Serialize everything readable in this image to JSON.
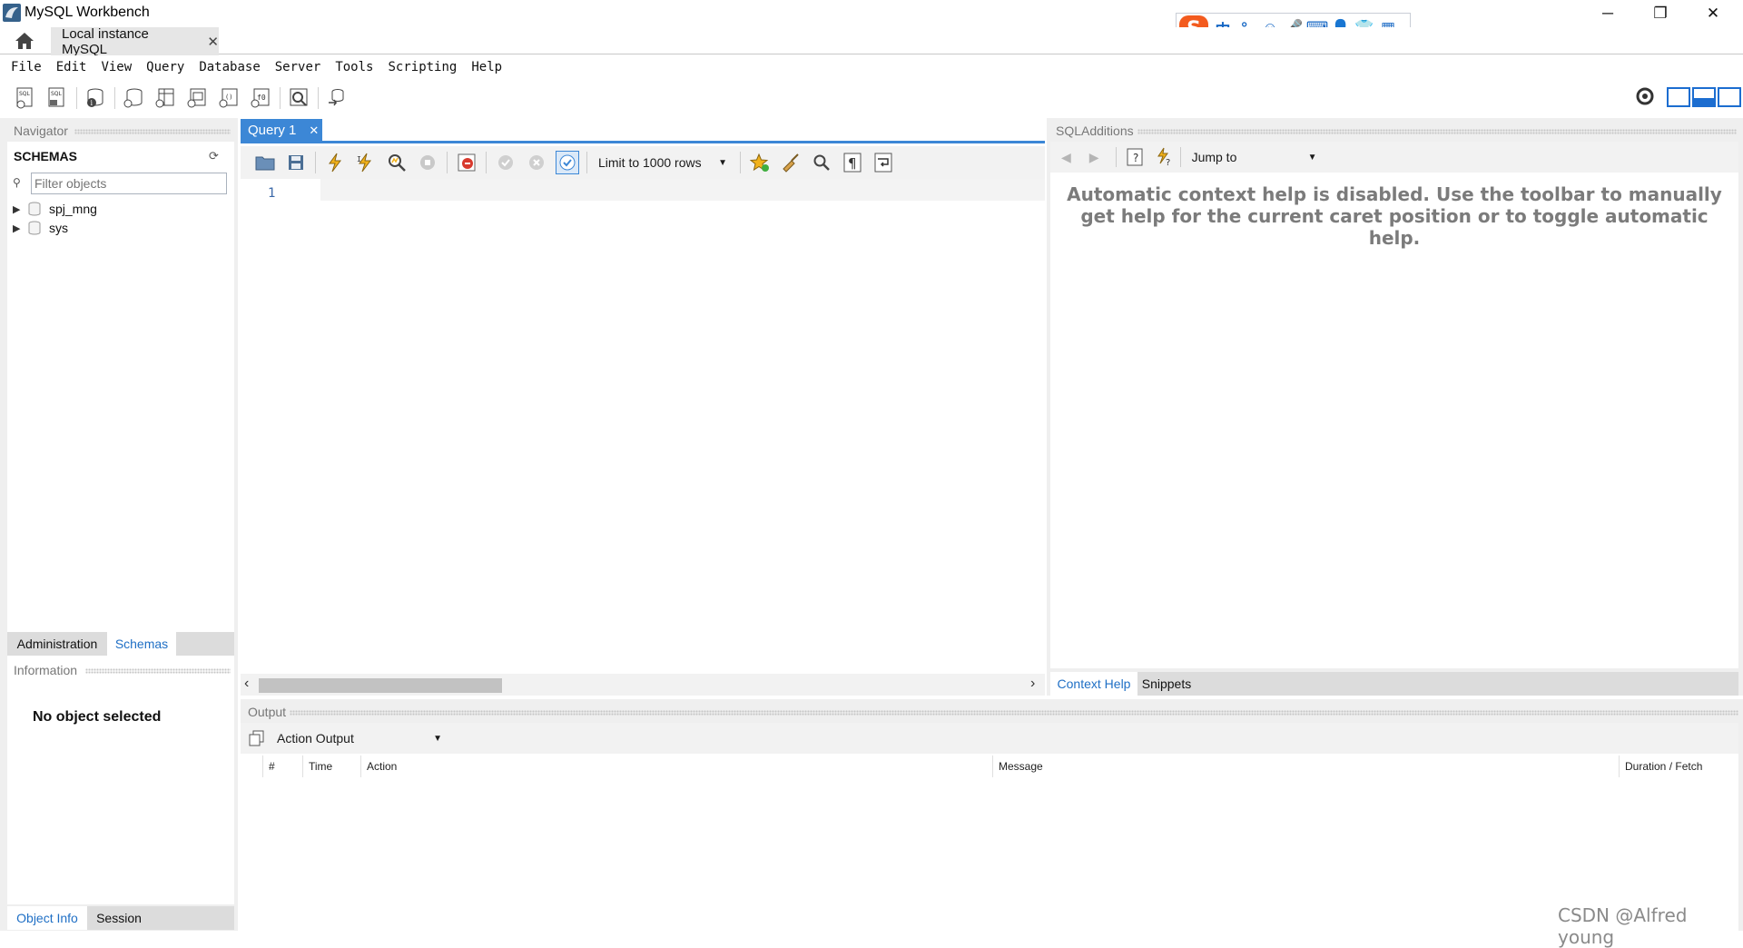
{
  "window": {
    "title": "MySQL Workbench",
    "controls": [
      "─",
      "❐",
      "✕"
    ]
  },
  "ime": {
    "items": [
      "中",
      "°,",
      "☺",
      "🎤",
      "⌨",
      "👤",
      "👕",
      "▦"
    ]
  },
  "tabs": {
    "connection_tab": "Local instance MySQL",
    "close": "✕"
  },
  "menu": {
    "items": [
      "File",
      "Edit",
      "View",
      "Query",
      "Database",
      "Server",
      "Tools",
      "Scripting",
      "Help"
    ]
  },
  "navigator": {
    "title": "Navigator",
    "schemas_heading": "SCHEMAS",
    "filter_placeholder": "Filter objects",
    "schemas": [
      "spj_mng",
      "sys"
    ],
    "tabs": [
      "Administration",
      "Schemas"
    ],
    "active_tab": "Schemas"
  },
  "information": {
    "title": "Information",
    "message": "No object selected",
    "tabs": [
      "Object Info",
      "Session"
    ],
    "active_tab": "Object Info"
  },
  "query": {
    "tab_label": "Query 1",
    "tab_close": "✕",
    "limit_label": "Limit to 1000 rows",
    "line_number": "1"
  },
  "sql_additions": {
    "title": "SQLAdditions",
    "jump_to": "Jump to",
    "help_text": "Automatic context help is disabled. Use the toolbar to manually get help for the current caret position or to toggle automatic help.",
    "tabs": [
      "Context Help",
      "Snippets"
    ],
    "active_tab": "Context Help"
  },
  "output": {
    "title": "Output",
    "selector": "Action Output",
    "columns": [
      "#",
      "Time",
      "Action",
      "Message",
      "Duration / Fetch"
    ]
  },
  "watermark": "CSDN @Alfred young",
  "colors": {
    "accent": "#3c87d6",
    "link_tab": "#1f6fc5",
    "panel": "#efefef"
  }
}
